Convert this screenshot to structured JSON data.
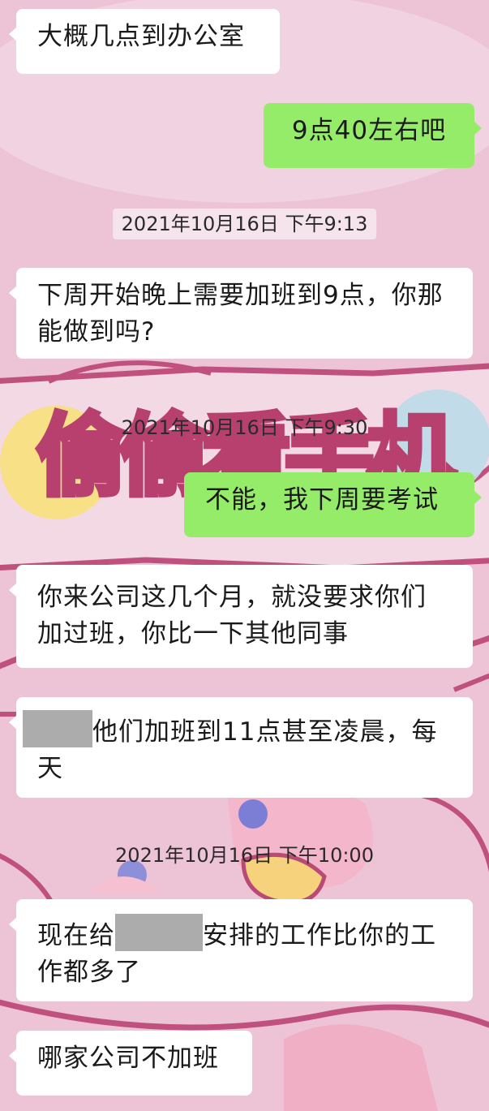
{
  "colors": {
    "background": "#ecc4d6",
    "incoming_bubble": "#ffffff",
    "outgoing_bubble": "#95ec69",
    "redaction": "#acacac"
  },
  "wallpaper": {
    "text": "偷偷看手机"
  },
  "messages": [
    {
      "type": "incoming",
      "text": "大概几点到办公室"
    },
    {
      "type": "outgoing",
      "text": "9点40左右吧"
    },
    {
      "type": "timestamp",
      "text": "2021年10月16日 下午9:13"
    },
    {
      "type": "incoming",
      "text": "下周开始晚上需要加班到9点，你那能做到吗?"
    },
    {
      "type": "timestamp",
      "text": "2021年10月16日 下午9:30"
    },
    {
      "type": "outgoing",
      "text": "不能，我下周要考试"
    },
    {
      "type": "incoming",
      "text": "你来公司这几个月，就没要求你们加过班，你比一下其他同事"
    },
    {
      "type": "incoming",
      "text_line1": "他们加班到11点甚至凌晨，每",
      "text_line2": "天",
      "redacted": true
    },
    {
      "type": "timestamp",
      "text": "2021年10月16日 下午10:00"
    },
    {
      "type": "incoming",
      "text_prefix": "现在给",
      "text_suffix": "安排的工作比你的工",
      "text_line2": "作都多了",
      "redacted": true
    },
    {
      "type": "incoming",
      "text": "哪家公司不加班"
    }
  ]
}
